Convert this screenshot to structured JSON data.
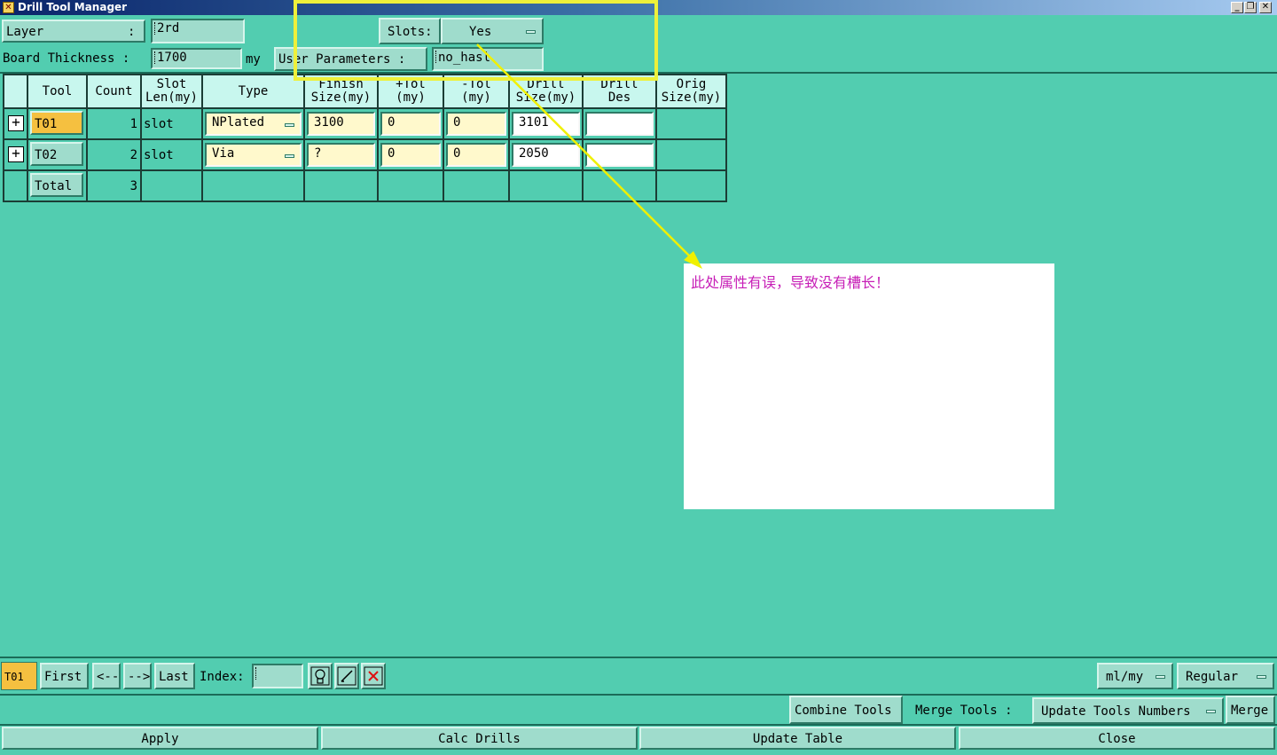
{
  "window": {
    "title": "Drill Tool Manager"
  },
  "header": {
    "layer_label": "Layer",
    "layer_colon": ":",
    "layer_value": "2rd",
    "slots_label": "Slots:",
    "slots_value": "Yes",
    "thickness_label": "Board Thickness :",
    "thickness_value": "1700",
    "thickness_unit": "my",
    "user_params_label": "User Parameters :",
    "user_params_value": "no_hasl"
  },
  "table": {
    "columns": [
      "Tool",
      "Count",
      "Slot\nLen(my)",
      "Type",
      "Finish\nSize(my)",
      "+Tol\n(my)",
      "-Tol\n(my)",
      "Drill\nSize(my)",
      "Drill\nDes",
      "Orig\nSize(my)"
    ],
    "rows": [
      {
        "tool": "T01",
        "count": "1",
        "slot": "slot",
        "type": "NPlated",
        "finish": "3100",
        "ptol": "0",
        "mtol": "0",
        "drill": "3101",
        "des": "",
        "orig": ""
      },
      {
        "tool": "T02",
        "count": "2",
        "slot": "slot",
        "type": "Via",
        "finish": "?",
        "ptol": "0",
        "mtol": "0",
        "drill": "2050",
        "des": "",
        "orig": ""
      }
    ],
    "total_label": "Total",
    "total_count": "3"
  },
  "annotation": {
    "text": "此处属性有误，导致没有槽长！",
    "color": "#c71fb7",
    "highlight_color": "#eef03a"
  },
  "nav": {
    "current_tool": "T01",
    "first": "First",
    "prev": "<--",
    "next": "-->",
    "last": "Last",
    "index_label": "Index:",
    "index_value": "",
    "units": "ml/my",
    "mode": "Regular"
  },
  "actions": {
    "combine": "Combine Tools",
    "merge_tools_label": "Merge Tools :",
    "update_numbers": "Update Tools Numbers",
    "merge": "Merge",
    "apply": "Apply",
    "calc": "Calc Drills",
    "update_table": "Update Table",
    "close": "Close"
  }
}
